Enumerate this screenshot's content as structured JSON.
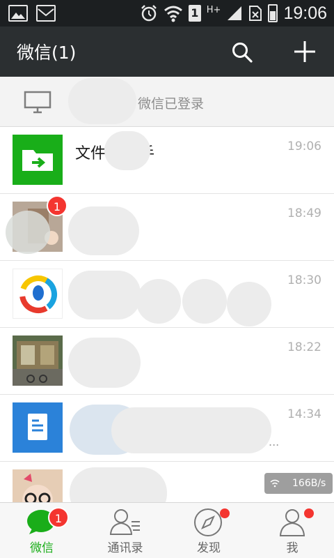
{
  "status_bar": {
    "network_type": "H+",
    "sim_slot": "1",
    "time": "19:06"
  },
  "header": {
    "title": "微信(1)"
  },
  "login_banner": {
    "text": "微信已登录"
  },
  "chats": [
    {
      "name": "文件",
      "name_suffix": "手",
      "time": "19:06",
      "preview": "",
      "badge": ""
    },
    {
      "name": "",
      "time": "18:49",
      "preview": "",
      "badge": "1"
    },
    {
      "name": "",
      "time": "18:30",
      "preview": "",
      "badge": ""
    },
    {
      "name": "",
      "time": "18:22",
      "preview": "",
      "badge": ""
    },
    {
      "name": "",
      "time": "14:34",
      "preview": "...",
      "badge": ""
    },
    {
      "name": "",
      "time": "",
      "preview": "",
      "badge": ""
    }
  ],
  "network_speed": "166B/s",
  "tabs": [
    {
      "label": "微信",
      "badge": "1",
      "active": true
    },
    {
      "label": "通讯录"
    },
    {
      "label": "发现",
      "dot": true
    },
    {
      "label": "我",
      "dot": true
    }
  ],
  "colors": {
    "status_bar_bg": "#1c1f21",
    "title_bar_bg": "#2b2f31",
    "accent_green": "#1aad19",
    "badge_red": "#f43530",
    "file_helper_green": "#19ae19",
    "doc_blue": "#2b82d9"
  }
}
